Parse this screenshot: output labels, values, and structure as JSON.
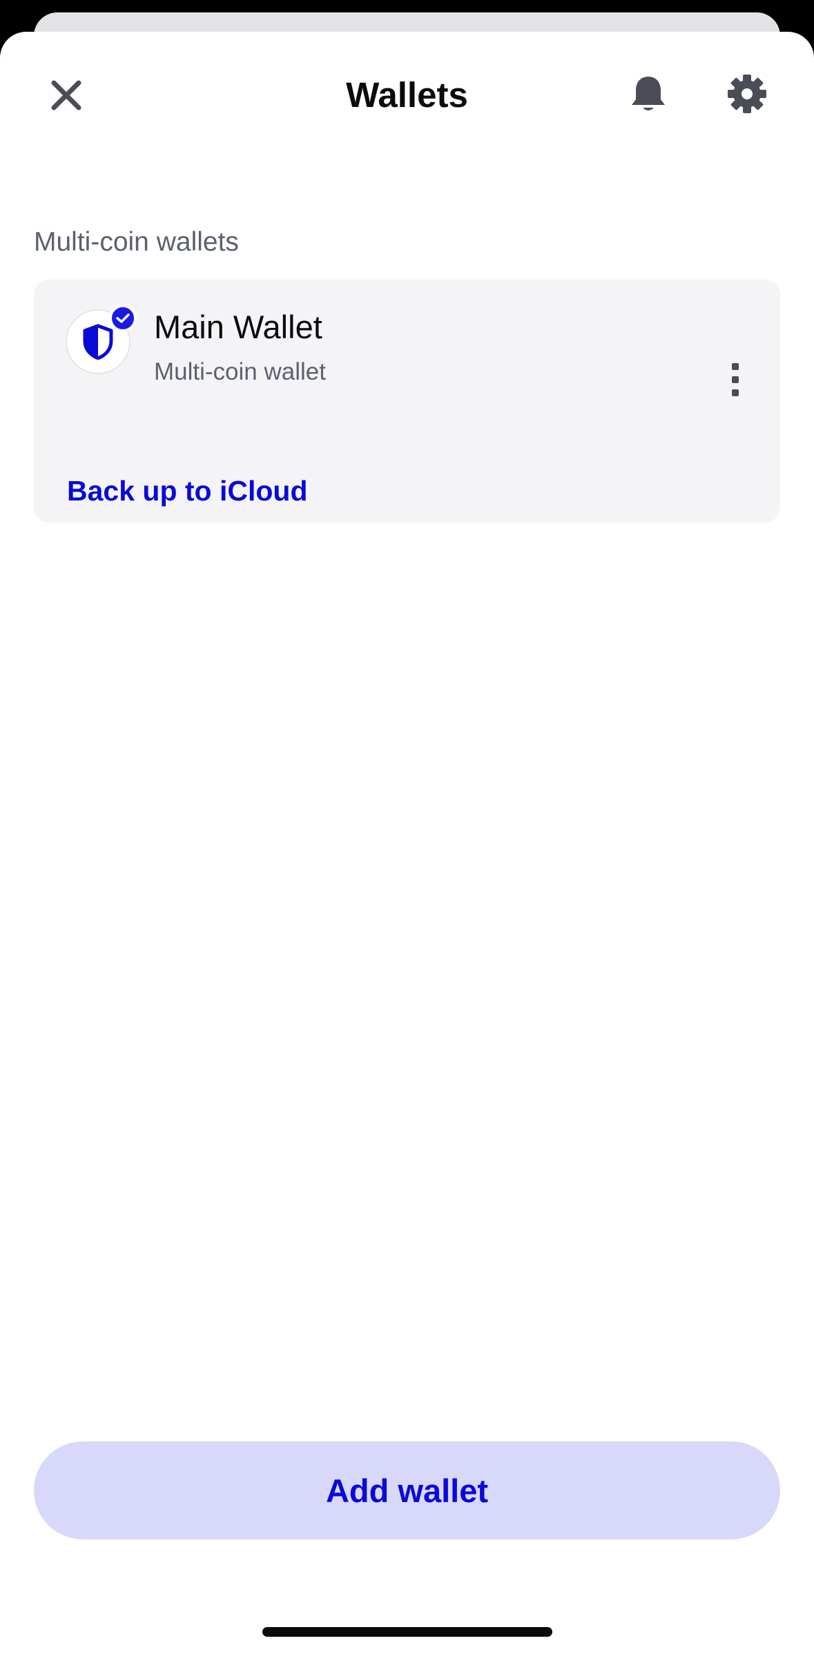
{
  "header": {
    "title": "Wallets",
    "close_icon": "close-icon",
    "notifications_icon": "bell-icon",
    "settings_icon": "gear-icon"
  },
  "section": {
    "label": "Multi-coin wallets"
  },
  "wallet": {
    "name": "Main Wallet",
    "subtitle": "Multi-coin wallet",
    "icon": "shield-icon",
    "selected_badge": "check-icon",
    "more_icon": "more-vertical-icon",
    "backup_link": "Back up to iCloud"
  },
  "footer": {
    "add_wallet_label": "Add wallet"
  },
  "colors": {
    "accent": "#0a0ad8",
    "button_bg": "#d8d8fa",
    "card_bg": "#f4f4f6",
    "text_primary": "#0a0b0d",
    "text_secondary": "#5b616e"
  }
}
